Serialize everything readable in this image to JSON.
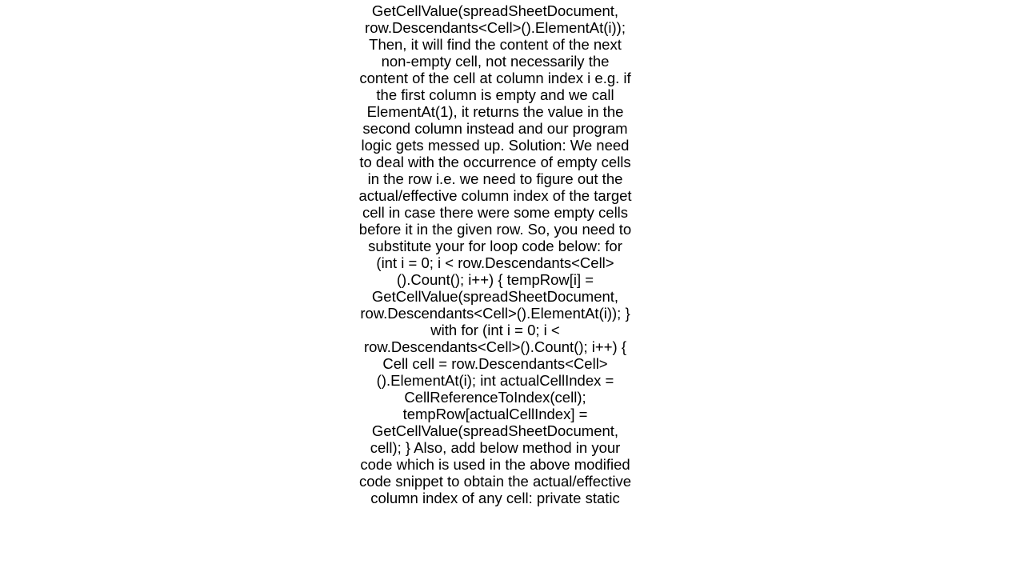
{
  "document": {
    "body_text": "this: GetCellValue(spreadSheetDocument, row.Descendants<Cell>().ElementAt(i));  Then, it will find the content of the next non-empty cell, not necessarily the content of the cell at column index i e.g.  if the first column is empty and we call ElementAt(1), it returns the value in the second column instead and our program logic gets messed up.  Solution:  We need to deal with the occurrence of empty cells in the row i.e. we need to figure out the actual/effective column index of the target cell in case there were some empty cells before it in the given row.  So, you need to substitute your for loop code below: for (int i = 0; i < row.Descendants<Cell>().Count(); i++) { tempRow[i] = GetCellValue(spreadSheetDocument, row.Descendants<Cell>().ElementAt(i)); }  with for (int i = 0; i < row.Descendants<Cell>().Count(); i++) { Cell cell = row.Descendants<Cell>().ElementAt(i); int actualCellIndex = CellReferenceToIndex(cell); tempRow[actualCellIndex] = GetCellValue(spreadSheetDocument, cell); }  Also, add below method in your code which is used in the above modified code snippet to obtain the actual/effective column index of any cell: private static"
  }
}
